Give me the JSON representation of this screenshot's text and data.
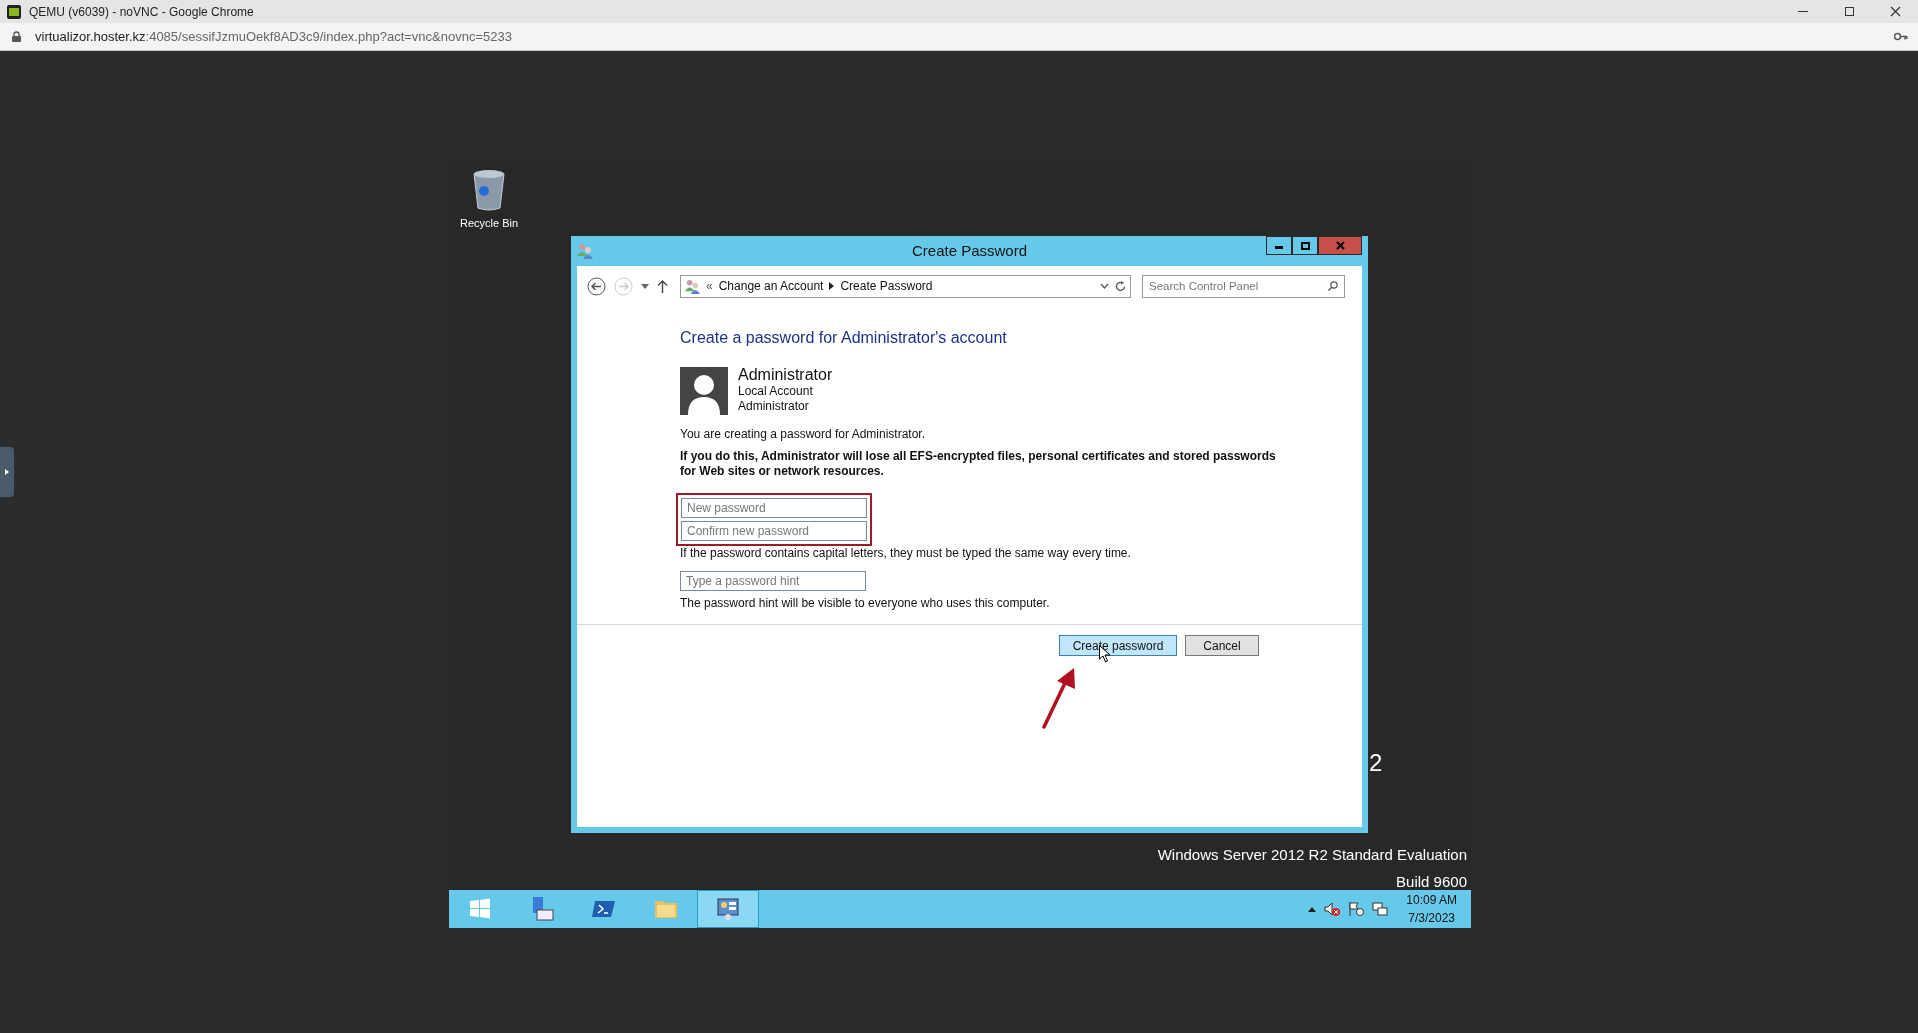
{
  "browser": {
    "title": "QEMU (v6039) - noVNC - Google Chrome",
    "url_host": "virtualizor.hoster.kz",
    "url_rest": ":4085/sessifJzmuOekf8AD3c9/index.php?act=vnc&novnc=5233"
  },
  "desktop": {
    "icons": [
      {
        "label": "Recycle Bin"
      }
    ],
    "partial_text": "2",
    "branding": [
      "Windows Server 2012 R2 Standard Evaluation",
      "Build 9600"
    ]
  },
  "window": {
    "title": "Create Password",
    "breadcrumb_prefix": "«",
    "breadcrumb": [
      "Change an Account",
      "Create Password"
    ],
    "search": {
      "placeholder": "Search Control Panel"
    },
    "heading": "Create a password for Administrator's account",
    "account": {
      "name": "Administrator",
      "type": "Local Account",
      "role": "Administrator"
    },
    "intro": "You are creating a password for Administrator.",
    "warning": "If you do this, Administrator will lose all EFS-encrypted files, personal certificates and stored passwords for Web sites or network resources.",
    "password_fields": [
      {
        "placeholder": "New password"
      },
      {
        "placeholder": "Confirm new password"
      }
    ],
    "password_fields_highlighted": true,
    "capital_note": "If the password contains capital letters, they must be typed the same way every time.",
    "hint_field": {
      "placeholder": "Type a password hint"
    },
    "hint_note": "The password hint will be visible to everyone who uses this computer.",
    "buttons": [
      {
        "label": "Create password",
        "kind": "primary"
      },
      {
        "label": "Cancel",
        "kind": "secondary"
      }
    ]
  },
  "taskbar": {
    "items": [
      {
        "kind": "start",
        "selected": false
      },
      {
        "kind": "server",
        "selected": false
      },
      {
        "kind": "shell",
        "selected": false
      },
      {
        "kind": "folder",
        "selected": false
      },
      {
        "kind": "panel",
        "selected": true
      }
    ],
    "time": "10:09 AM",
    "date": "7/3/2023"
  }
}
